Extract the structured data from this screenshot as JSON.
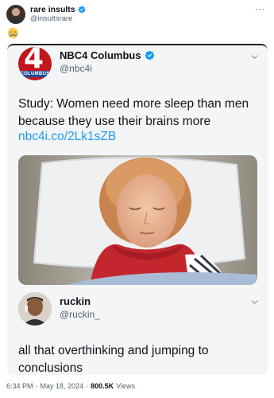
{
  "outer_tweet": {
    "author_name": "rare insults",
    "handle": "@insultsrare",
    "more_label": "···",
    "emoji_name": "crying-face-emoji",
    "footer": {
      "time": "6:34 PM",
      "sep1": "·",
      "date": "May 18, 2024",
      "sep2": "·",
      "views_count": "800.5K",
      "views_label": "Views"
    }
  },
  "quoted_tweet": {
    "author_name": "NBC4 Columbus",
    "handle": "@nbc4i",
    "avatar_number": "4",
    "avatar_band_text": "COLUMBUS",
    "text": "Study: Women need more sleep than men because they use their brains more",
    "link": "nbc4i.co/2Lk1sZB",
    "image_desc_icon": "sleeping-woman-photo"
  },
  "reply": {
    "author_name": "ruckin",
    "handle": "@ruckin_",
    "text": "all that overthinking and jumping to conclusions"
  },
  "colors": {
    "verified": "#1d9bf0",
    "link": "#1d9bf0",
    "muted": "#536471",
    "nbc_red": "#c2161d"
  }
}
